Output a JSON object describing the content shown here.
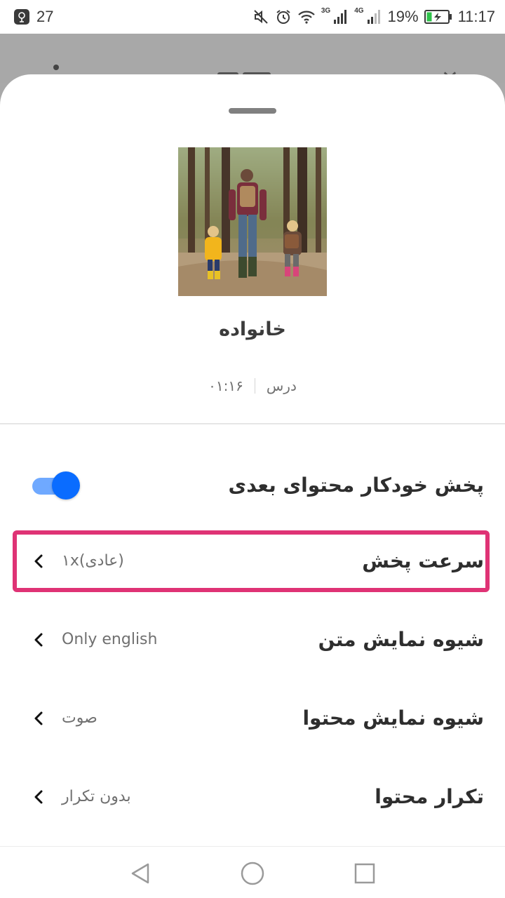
{
  "status_bar": {
    "notification_count": "27",
    "battery_percent": "19%",
    "time": "11:17",
    "net_3g": "3G",
    "net_4g": "4G",
    "icons": [
      "mute-icon",
      "alarm-icon",
      "wifi-icon",
      "signal-icon",
      "battery-charging-icon"
    ]
  },
  "sheet": {
    "lesson_title": "خانواده",
    "lesson_type": "درس",
    "duration": "۰۱:۱۶"
  },
  "settings": [
    {
      "label": "پخش خودکار محتوای بعدی",
      "control": "toggle",
      "on": true
    },
    {
      "label": "سرعت پخش",
      "value": "(عادی)۱x",
      "highlighted": true
    },
    {
      "label": "شیوه نمایش متن",
      "value": "Only english"
    },
    {
      "label": "شیوه نمایش محتوا",
      "value": "صوت"
    },
    {
      "label": "تکرار محتوا",
      "value": "بدون تکرار"
    }
  ],
  "colors": {
    "accent": "#0a6cff",
    "toggle_track": "#6fa9ff",
    "highlight_border": "#df3375"
  }
}
